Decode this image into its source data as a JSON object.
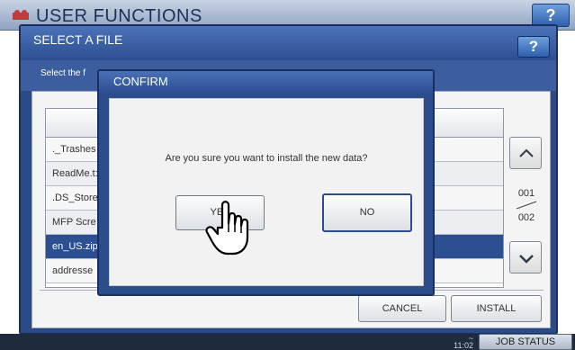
{
  "app": {
    "title": "USER FUNCTIONS",
    "help_label": "?"
  },
  "dialog": {
    "title": "SELECT A FILE",
    "help_label": "?",
    "instruction": "Select the f",
    "files": [
      {
        "label": "._Trashes",
        "selected": false
      },
      {
        "label": "ReadMe.t:",
        "selected": false
      },
      {
        "label": ".DS_Store",
        "selected": false
      },
      {
        "label": "MFP Scre",
        "selected": false
      },
      {
        "label": "en_US.zip",
        "selected": true
      },
      {
        "label": "addresse",
        "selected": false
      }
    ],
    "page_current": "001",
    "page_total": "002",
    "cancel_label": "CANCEL",
    "install_label": "INSTALL"
  },
  "confirm": {
    "title": "CONFIRM",
    "message": "Are you sure you want to install the new data?",
    "yes_label": "YES",
    "no_label": "NO"
  },
  "footer": {
    "time_top": "~",
    "time_bottom": "11:02",
    "job_status_label": "JOB STATUS"
  },
  "colors": {
    "frame": "#2b4a86",
    "selected_row": "#2c4f92",
    "help_button": "#2f5fae"
  },
  "icons": {
    "app_logo": "user-functions-logo-icon",
    "scroll_up": "chevron-up-icon",
    "scroll_down": "chevron-down-icon",
    "cursor": "hand-pointer-icon"
  }
}
